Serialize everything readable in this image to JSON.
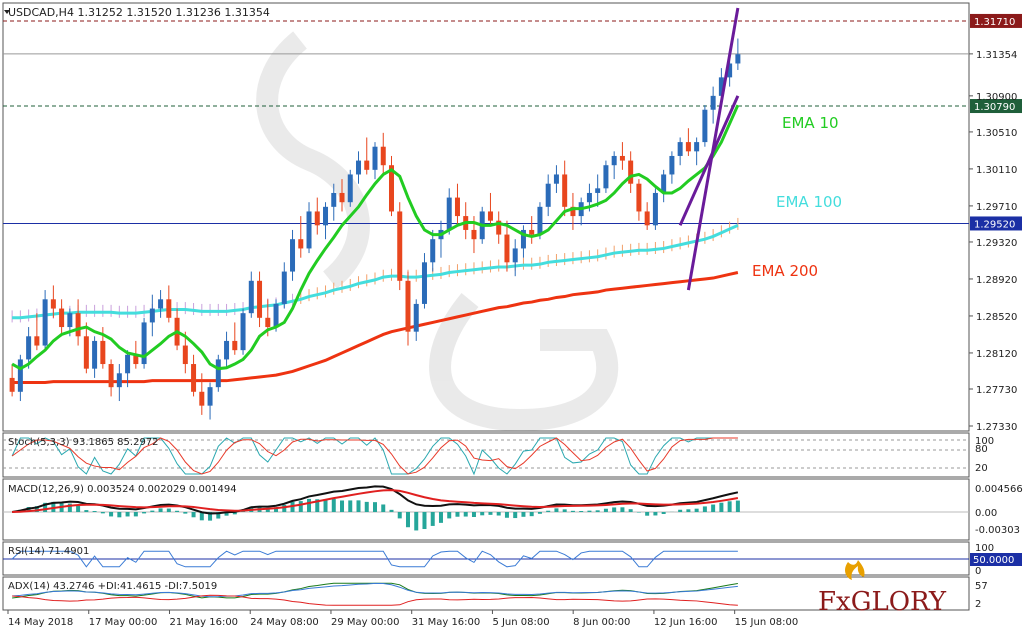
{
  "chart_data": {
    "type": "candlestick",
    "header": "USDCAD,H4  1.31252 1.31520 1.31236 1.31354",
    "price_axis": {
      "ticks": [
        "1.31710",
        "1.31354",
        "1.30900",
        "1.30790",
        "1.30510",
        "1.30110",
        "1.29710",
        "1.29520",
        "1.29320",
        "1.28920",
        "1.28520",
        "1.28120",
        "1.27730",
        "1.27330"
      ],
      "ylim": [
        1.2733,
        1.3185
      ]
    },
    "highlight_levels": [
      {
        "label": "1.31710",
        "value": 1.3171,
        "color": "#8b1a1a"
      },
      {
        "label": "1.30790",
        "value": 1.3079,
        "color": "#1f5f3a"
      },
      {
        "label": "1.29520",
        "value": 1.2952,
        "color": "#1b2fa5"
      }
    ],
    "current_price": {
      "label": "1.31354",
      "value": 1.31354
    },
    "x_ticks": [
      "14 May 2018",
      "17 May 00:00",
      "21 May 16:00",
      "24 May 08:00",
      "29 May 00:00",
      "31 May 16:00",
      "5 Jun 08:00",
      "8 Jun 00:00",
      "12 Jun 16:00",
      "15 Jun 08:00"
    ],
    "ema_labels": [
      {
        "text": "EMA 10",
        "color": "#22cc22"
      },
      {
        "text": "EMA 100",
        "color": "#44dddd"
      },
      {
        "text": "EMA 200",
        "color": "#ee3311"
      }
    ],
    "candles": [
      [
        1.2785,
        1.28,
        1.2765,
        1.277
      ],
      [
        1.277,
        1.281,
        1.276,
        1.2805
      ],
      [
        1.2805,
        1.284,
        1.2795,
        1.283
      ],
      [
        1.283,
        1.2855,
        1.2815,
        1.282
      ],
      [
        1.282,
        1.288,
        1.2815,
        1.287
      ],
      [
        1.287,
        1.2885,
        1.285,
        1.286
      ],
      [
        1.286,
        1.287,
        1.283,
        1.284
      ],
      [
        1.284,
        1.286,
        1.283,
        1.2855
      ],
      [
        1.2855,
        1.287,
        1.282,
        1.283
      ],
      [
        1.283,
        1.2845,
        1.279,
        1.2795
      ],
      [
        1.2795,
        1.283,
        1.2785,
        1.2825
      ],
      [
        1.2825,
        1.284,
        1.2795,
        1.28
      ],
      [
        1.28,
        1.2805,
        1.2765,
        1.2775
      ],
      [
        1.2775,
        1.28,
        1.276,
        1.279
      ],
      [
        1.279,
        1.2815,
        1.2775,
        1.281
      ],
      [
        1.281,
        1.2825,
        1.2795,
        1.28
      ],
      [
        1.28,
        1.285,
        1.2795,
        1.2845
      ],
      [
        1.2845,
        1.2875,
        1.283,
        1.286
      ],
      [
        1.286,
        1.288,
        1.285,
        1.287
      ],
      [
        1.287,
        1.2885,
        1.2845,
        1.285
      ],
      [
        1.285,
        1.286,
        1.2815,
        1.282
      ],
      [
        1.282,
        1.2835,
        1.279,
        1.28
      ],
      [
        1.28,
        1.281,
        1.2765,
        1.277
      ],
      [
        1.277,
        1.279,
        1.2745,
        1.2755
      ],
      [
        1.2755,
        1.278,
        1.274,
        1.2775
      ],
      [
        1.2775,
        1.281,
        1.277,
        1.2805
      ],
      [
        1.2805,
        1.2835,
        1.2795,
        1.2825
      ],
      [
        1.2825,
        1.2845,
        1.281,
        1.2815
      ],
      [
        1.2815,
        1.286,
        1.281,
        1.2855
      ],
      [
        1.2855,
        1.29,
        1.285,
        1.289
      ],
      [
        1.289,
        1.29,
        1.284,
        1.285
      ],
      [
        1.285,
        1.287,
        1.283,
        1.284
      ],
      [
        1.284,
        1.287,
        1.2835,
        1.2865
      ],
      [
        1.2865,
        1.291,
        1.286,
        1.29
      ],
      [
        1.29,
        1.2945,
        1.289,
        1.2935
      ],
      [
        1.2935,
        1.296,
        1.2915,
        1.2925
      ],
      [
        1.2925,
        1.2975,
        1.292,
        1.2965
      ],
      [
        1.2965,
        1.298,
        1.294,
        1.295
      ],
      [
        1.295,
        1.2975,
        1.2935,
        1.297
      ],
      [
        1.297,
        1.2995,
        1.2955,
        1.2985
      ],
      [
        1.2985,
        1.3,
        1.2965,
        1.2975
      ],
      [
        1.2975,
        1.301,
        1.297,
        1.3005
      ],
      [
        1.3005,
        1.303,
        1.2995,
        1.302
      ],
      [
        1.302,
        1.3045,
        1.3005,
        1.301
      ],
      [
        1.301,
        1.304,
        1.3,
        1.3035
      ],
      [
        1.3035,
        1.305,
        1.3005,
        1.3015
      ],
      [
        1.3015,
        1.3025,
        1.296,
        1.2965
      ],
      [
        1.2965,
        1.2975,
        1.288,
        1.289
      ],
      [
        1.289,
        1.29,
        1.282,
        1.2835
      ],
      [
        1.2835,
        1.287,
        1.2825,
        1.2865
      ],
      [
        1.2865,
        1.292,
        1.286,
        1.291
      ],
      [
        1.291,
        1.2945,
        1.29,
        1.2935
      ],
      [
        1.2935,
        1.2955,
        1.2915,
        1.2945
      ],
      [
        1.2945,
        1.299,
        1.294,
        1.298
      ],
      [
        1.298,
        1.2995,
        1.295,
        1.296
      ],
      [
        1.296,
        1.2975,
        1.2935,
        1.2945
      ],
      [
        1.2945,
        1.296,
        1.292,
        1.2935
      ],
      [
        1.2935,
        1.297,
        1.293,
        1.2965
      ],
      [
        1.2965,
        1.2985,
        1.295,
        1.2955
      ],
      [
        1.2955,
        1.2965,
        1.293,
        1.294
      ],
      [
        1.294,
        1.2955,
        1.29,
        1.291
      ],
      [
        1.291,
        1.2935,
        1.2895,
        1.2925
      ],
      [
        1.2925,
        1.295,
        1.2915,
        1.2945
      ],
      [
        1.2945,
        1.296,
        1.293,
        1.294
      ],
      [
        1.294,
        1.2975,
        1.2935,
        1.297
      ],
      [
        1.297,
        1.3005,
        1.296,
        1.2995
      ],
      [
        1.2995,
        1.3015,
        1.2985,
        1.3005
      ],
      [
        1.3005,
        1.302,
        1.296,
        1.297
      ],
      [
        1.297,
        1.2985,
        1.2945,
        1.296
      ],
      [
        1.296,
        1.298,
        1.295,
        1.2975
      ],
      [
        1.2975,
        1.2995,
        1.2965,
        1.2985
      ],
      [
        1.2985,
        1.3005,
        1.297,
        1.299
      ],
      [
        1.299,
        1.302,
        1.2985,
        1.3015
      ],
      [
        1.3015,
        1.303,
        1.3,
        1.3025
      ],
      [
        1.3025,
        1.304,
        1.301,
        1.302
      ],
      [
        1.302,
        1.303,
        1.2985,
        1.2995
      ],
      [
        1.2995,
        1.3,
        1.2955,
        1.2965
      ],
      [
        1.2965,
        1.2975,
        1.2945,
        1.295
      ],
      [
        1.295,
        1.299,
        1.2945,
        1.2985
      ],
      [
        1.2985,
        1.301,
        1.2975,
        1.3005
      ],
      [
        1.3005,
        1.303,
        1.2995,
        1.3025
      ],
      [
        1.3025,
        1.3045,
        1.3015,
        1.304
      ],
      [
        1.304,
        1.3055,
        1.3025,
        1.303
      ],
      [
        1.303,
        1.3045,
        1.3015,
        1.304
      ],
      [
        1.304,
        1.308,
        1.3035,
        1.3075
      ],
      [
        1.3075,
        1.31,
        1.306,
        1.309
      ],
      [
        1.309,
        1.312,
        1.308,
        1.311
      ],
      [
        1.311,
        1.3135,
        1.31,
        1.3125
      ],
      [
        1.3125,
        1.3152,
        1.3118,
        1.3135
      ]
    ],
    "overlays": {
      "ema10": [
        1.28,
        1.2795,
        1.28,
        1.2808,
        1.2815,
        1.2825,
        1.2832,
        1.2835,
        1.2838,
        1.284,
        1.2835,
        1.2832,
        1.2827,
        1.2818,
        1.2812,
        1.281,
        1.2808,
        1.2815,
        1.2822,
        1.283,
        1.2835,
        1.283,
        1.2822,
        1.2813,
        1.28,
        1.2795,
        1.2796,
        1.28,
        1.2805,
        1.2815,
        1.283,
        1.2837,
        1.284,
        1.2845,
        1.286,
        1.288,
        1.2898,
        1.2912,
        1.2925,
        1.2937,
        1.295,
        1.296,
        1.297,
        1.2983,
        1.2995,
        1.3005,
        1.301,
        1.3003,
        1.298,
        1.296,
        1.2945,
        1.294,
        1.294,
        1.2945,
        1.295,
        1.2953,
        1.2953,
        1.295,
        1.295,
        1.2952,
        1.295,
        1.2945,
        1.294,
        1.2938,
        1.294,
        1.2945,
        1.2955,
        1.2965,
        1.2968,
        1.2968,
        1.297,
        1.2973,
        1.2977,
        1.2985,
        1.2995,
        1.3003,
        1.3005,
        1.3,
        1.2992,
        1.2985,
        1.2985,
        1.299,
        1.2998,
        1.3005,
        1.3012,
        1.3025,
        1.304,
        1.306,
        1.308
      ],
      "ema100": [
        1.285,
        1.285,
        1.2851,
        1.2852,
        1.2853,
        1.2854,
        1.2855,
        1.2855,
        1.2856,
        1.2856,
        1.2856,
        1.2856,
        1.2856,
        1.2855,
        1.2855,
        1.2855,
        1.2856,
        1.2857,
        1.2858,
        1.2859,
        1.2859,
        1.2859,
        1.2858,
        1.2857,
        1.2857,
        1.2857,
        1.2857,
        1.2858,
        1.2859,
        1.2861,
        1.2862,
        1.2863,
        1.2864,
        1.2866,
        1.2868,
        1.287,
        1.2873,
        1.2875,
        1.2877,
        1.288,
        1.2882,
        1.2884,
        1.2887,
        1.2889,
        1.2891,
        1.2894,
        1.2895,
        1.2895,
        1.2894,
        1.2894,
        1.2895,
        1.2896,
        1.2897,
        1.2899,
        1.29,
        1.2901,
        1.2902,
        1.2903,
        1.2904,
        1.2905,
        1.2905,
        1.2906,
        1.2907,
        1.2907,
        1.2908,
        1.291,
        1.2911,
        1.2912,
        1.2913,
        1.2914,
        1.2915,
        1.2916,
        1.2918,
        1.292,
        1.2921,
        1.2922,
        1.2923,
        1.2923,
        1.2924,
        1.2925,
        1.2927,
        1.2929,
        1.2931,
        1.2933,
        1.2935,
        1.2938,
        1.2942,
        1.2946,
        1.295
      ],
      "ema200": [
        1.278,
        1.278,
        1.278,
        1.278,
        1.278,
        1.2781,
        1.2781,
        1.2781,
        1.2781,
        1.2781,
        1.2781,
        1.2781,
        1.2781,
        1.2781,
        1.2781,
        1.2781,
        1.2781,
        1.2782,
        1.2782,
        1.2782,
        1.2782,
        1.2782,
        1.2782,
        1.2782,
        1.2782,
        1.2782,
        1.2782,
        1.2783,
        1.2784,
        1.2785,
        1.2786,
        1.2787,
        1.2788,
        1.279,
        1.2792,
        1.2795,
        1.2798,
        1.2801,
        1.2804,
        1.2808,
        1.2812,
        1.2816,
        1.282,
        1.2824,
        1.2828,
        1.2832,
        1.2835,
        1.2837,
        1.2839,
        1.2841,
        1.2843,
        1.2845,
        1.2847,
        1.2849,
        1.2851,
        1.2853,
        1.2855,
        1.2857,
        1.2859,
        1.2861,
        1.2862,
        1.2864,
        1.2866,
        1.2867,
        1.2869,
        1.287,
        1.2872,
        1.2873,
        1.2875,
        1.2876,
        1.2877,
        1.2878,
        1.288,
        1.2881,
        1.2882,
        1.2883,
        1.2884,
        1.2885,
        1.2886,
        1.2887,
        1.2888,
        1.2889,
        1.289,
        1.2891,
        1.2892,
        1.2893,
        1.2895,
        1.2897,
        1.2899
      ]
    },
    "indicators": [
      {
        "name": "Stoch",
        "header": "Stoch(5,3,3) 93.1865 85.2972",
        "axis": [
          "100",
          "80",
          "20"
        ]
      },
      {
        "name": "MACD",
        "header": "MACD(12,26,9) 0.003524 0.002029 0.001494",
        "axis": [
          "0.004566",
          "0.00",
          "-0.00303"
        ]
      },
      {
        "name": "RSI",
        "header": "RSI(14) 71.4901",
        "axis": [
          "100",
          "50.0000",
          "0"
        ],
        "marker": "50.0000"
      },
      {
        "name": "ADX",
        "header": "ADX(14) 43.2746 +DI:41.4615 -DI:7.5019",
        "axis": [
          "57",
          "2"
        ]
      }
    ]
  },
  "logo": {
    "text": "FxGLORY"
  },
  "colors": {
    "bull": "#2b6bb8",
    "bear": "#e8461e",
    "channel": "#6a1b9a",
    "accent_red": "#8b1a1a"
  }
}
